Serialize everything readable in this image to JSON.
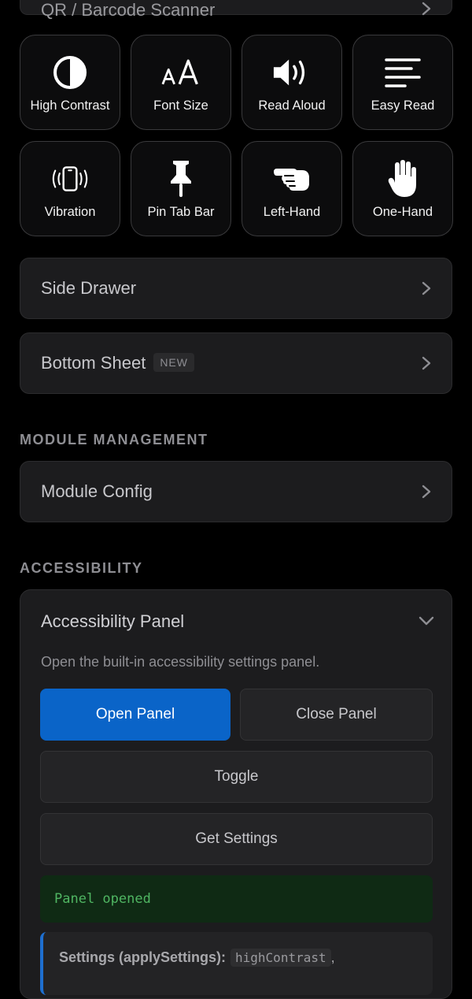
{
  "top_item": {
    "label": "QR / Barcode Scanner",
    "icon": "chevron-right-icon"
  },
  "tiles": [
    {
      "label": "High Contrast",
      "icon": "contrast-icon"
    },
    {
      "label": "Font Size",
      "icon": "font-size-icon"
    },
    {
      "label": "Read Aloud",
      "icon": "speaker-icon"
    },
    {
      "label": "Easy Read",
      "icon": "text-lines-icon"
    },
    {
      "label": "Vibration",
      "icon": "vibration-icon"
    },
    {
      "label": "Pin Tab Bar",
      "icon": "pin-icon"
    },
    {
      "label": "Left-Hand",
      "icon": "pointing-hand-icon"
    },
    {
      "label": "One-Hand",
      "icon": "hand-icon"
    }
  ],
  "side_drawer": {
    "label": "Side Drawer"
  },
  "bottom_sheet": {
    "label": "Bottom Sheet",
    "badge": "NEW"
  },
  "module_section": {
    "title": "MODULE MANAGEMENT"
  },
  "module_config": {
    "label": "Module Config"
  },
  "accessibility_section": {
    "title": "ACCESSIBILITY"
  },
  "panel": {
    "title": "Accessibility Panel",
    "description": "Open the built-in accessibility settings panel.",
    "open_label": "Open Panel",
    "close_label": "Close Panel",
    "toggle_label": "Toggle",
    "get_settings_label": "Get Settings",
    "status": "Panel opened",
    "settings_key": "Settings (applySettings):",
    "settings_code": "highContrast",
    "settings_after": ","
  },
  "colors": {
    "background": "#000000",
    "card": "#1c1c1e",
    "primary": "#0a64c8",
    "status_text": "#4fb562",
    "status_bg": "#0f2a14",
    "accent_bar": "#1e6fd0"
  }
}
